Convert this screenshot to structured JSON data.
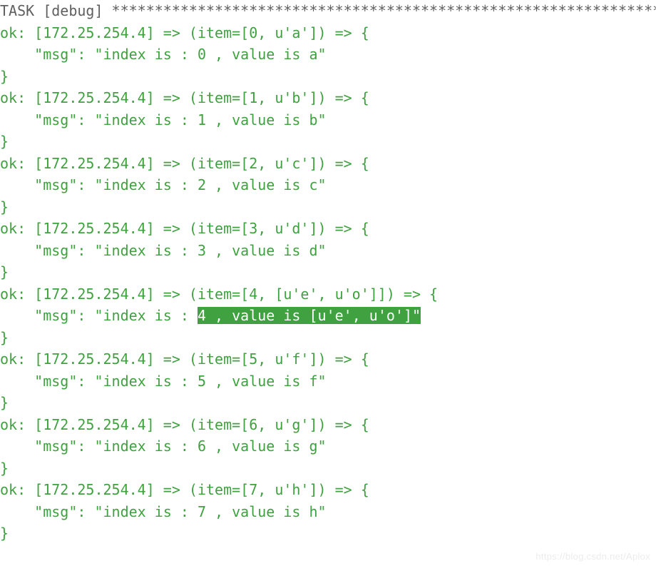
{
  "task_line": {
    "prefix": "TASK [debug] ",
    "stars": "************************************************************************>"
  },
  "host": "172.25.254.4",
  "items": [
    {
      "idx": 0,
      "item_repr": "[0, u'a']",
      "msg": "\"msg\": \"index is : 0 , value is a\""
    },
    {
      "idx": 1,
      "item_repr": "[1, u'b']",
      "msg": "\"msg\": \"index is : 1 , value is b\""
    },
    {
      "idx": 2,
      "item_repr": "[2, u'c']",
      "msg": "\"msg\": \"index is : 2 , value is c\""
    },
    {
      "idx": 3,
      "item_repr": "[3, u'd']",
      "msg": "\"msg\": \"index is : 3 , value is d\""
    },
    {
      "idx": 4,
      "item_repr": "[4, [u'e', u'o']]",
      "msg_prefix": "\"msg\": \"index is : ",
      "msg_hl": "4 , value is [u'e', u'o']\"",
      "highlighted": true
    },
    {
      "idx": 5,
      "item_repr": "[5, u'f']",
      "msg": "\"msg\": \"index is : 5 , value is f\""
    },
    {
      "idx": 6,
      "item_repr": "[6, u'g']",
      "msg": "\"msg\": \"index is : 6 , value is g\""
    },
    {
      "idx": 7,
      "item_repr": "[7, u'h']",
      "msg": "\"msg\": \"index is : 7 , value is h\""
    }
  ],
  "watermark": "https://blog.csdn.net/Aplox"
}
